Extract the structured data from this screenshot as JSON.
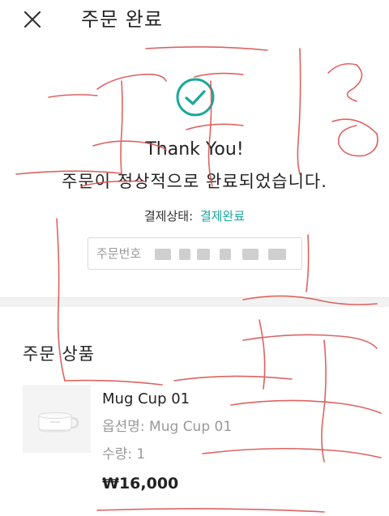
{
  "header": {
    "title": "주문 완료",
    "close_icon": "close-icon"
  },
  "confirmation": {
    "icon": "check-circle-icon",
    "accent_color": "#1aa89a",
    "thank_you": "Thank You!",
    "message": "주문이 정상적으로 완료되었습니다.",
    "payment_status_label": "결제상태:",
    "payment_status_value": "결제완료",
    "order_number_label": "주문번호"
  },
  "order_items": {
    "title": "주문 상품",
    "items": [
      {
        "name": "Mug Cup 01",
        "option": "옵션명: Mug Cup 01",
        "quantity": "수량: 1",
        "price": "₩16,000"
      }
    ]
  }
}
